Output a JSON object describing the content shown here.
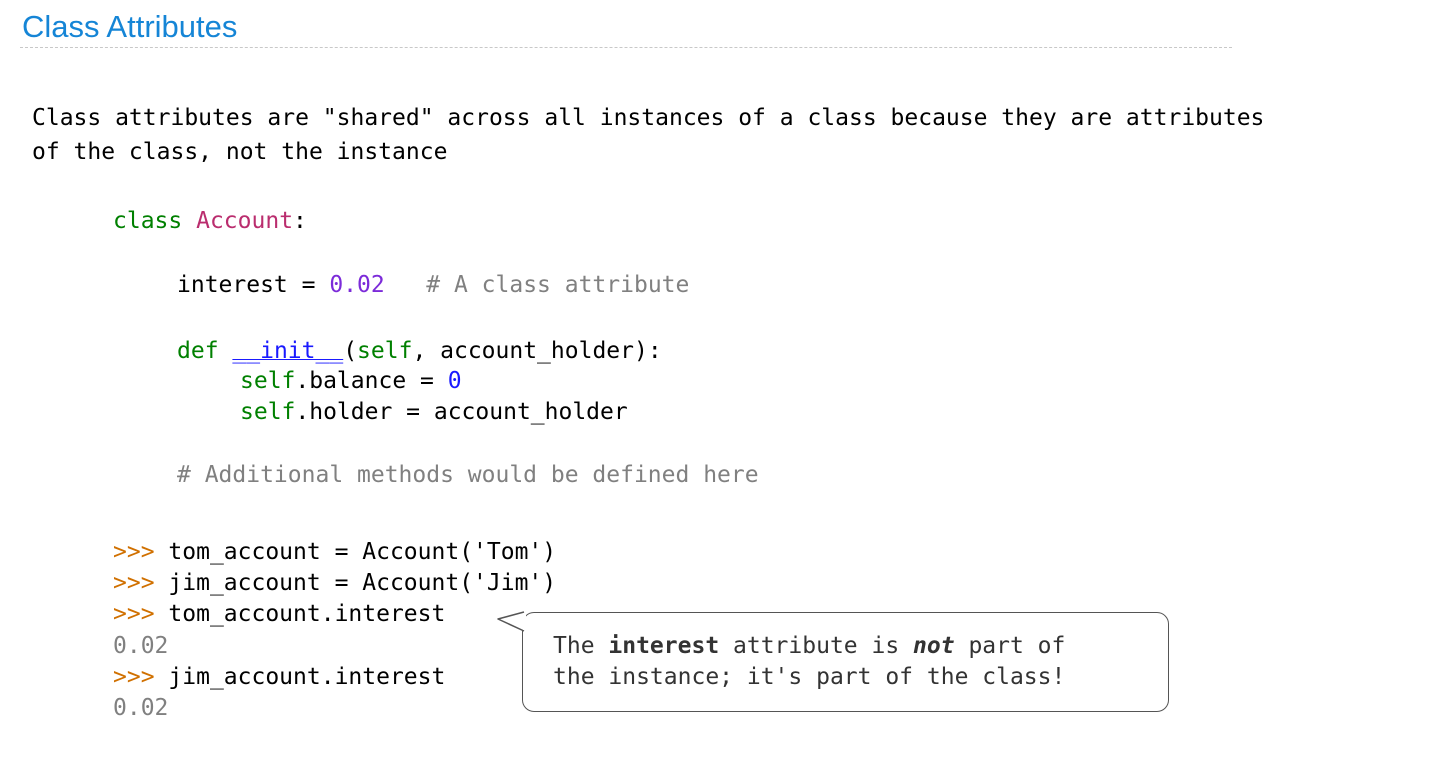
{
  "slide": {
    "title": "Class Attributes",
    "intro_line1": "Class attributes are \"shared\" across all instances of a class because they are attributes",
    "intro_line2": "of the class, not the instance"
  },
  "code": {
    "class_kw": "class",
    "class_name": "Account",
    "class_colon": ":",
    "interest_lhs": "interest = ",
    "interest_val": "0.02",
    "interest_comment": "# A class attribute",
    "def_kw": "def",
    "init_name": "__init__",
    "init_open": "(",
    "init_self": "self",
    "init_rest": ", account_holder):",
    "balance_self": "self",
    "balance_rest": ".balance = ",
    "balance_val": "0",
    "holder_self": "self",
    "holder_rest": ".holder = account_holder",
    "methods_comment": "# Additional methods would be defined here"
  },
  "session": {
    "prompt": ">>>",
    "line1": "tom_account = Account('Tom')",
    "line2": "jim_account = Account('Jim')",
    "line3": "tom_account.interest",
    "output1": "0.02",
    "line4": "jim_account.interest",
    "output2": "0.02"
  },
  "callout": {
    "t1": "The ",
    "bold": "interest",
    "t2": " attribute is ",
    "emph": "not",
    "t3": " part of",
    "line2": "the instance; it's part of the class!"
  }
}
